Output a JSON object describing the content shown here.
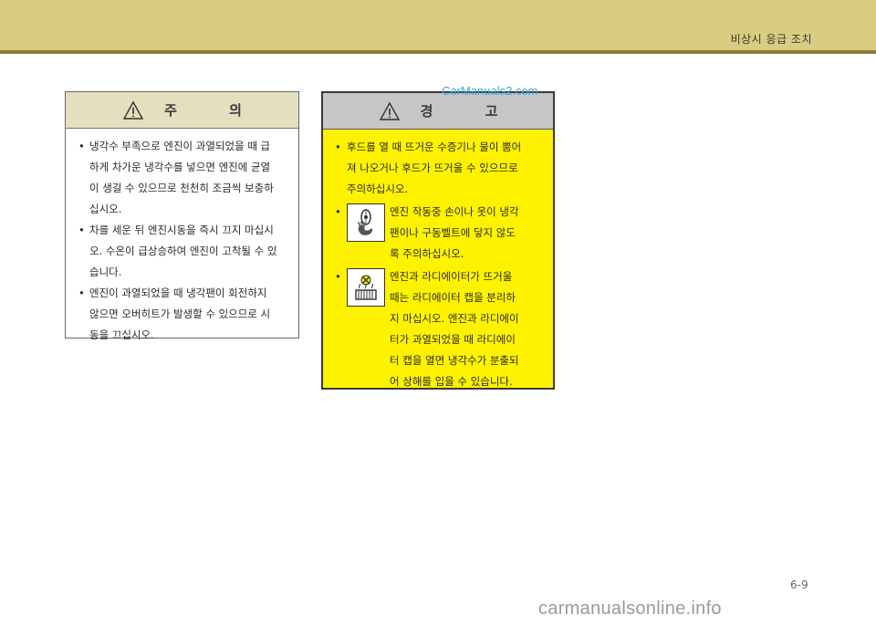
{
  "header": {
    "section_title": "비상시 응급 조치"
  },
  "caution": {
    "title": "주   의",
    "items": [
      {
        "lines": [
          "냉각수 부족으로 엔진이 과열되었을 때 급",
          "하게 차가운 냉각수를 넣으면 엔진에 균열",
          "이 생길 수 있으므로 천천히 조금씩 보충하",
          "십시오."
        ]
      },
      {
        "lines": [
          "차를 세운 뒤 엔진시동을 즉시 끄지 마십시",
          "오. 수온이 급상승하여 엔진이 고착될 수 있",
          "습니다."
        ]
      },
      {
        "lines": [
          "엔진이 과열되었을 때 냉각팬이 회전하지",
          "않으면 오버히트가 발생할 수 있으므로 시",
          "동을 끄십시오."
        ]
      }
    ]
  },
  "warning": {
    "title": "경   고",
    "item1": {
      "lines": [
        "후드를 열 때 뜨거운 수증기나 물이 뿜어",
        "져 나오거나 후드가 뜨거울 수 있으므로",
        "주의하십시오."
      ]
    },
    "item2": {
      "icon": "fan-hand-warning-icon",
      "lines": [
        "엔진 작동중 손이나 옷이 냉각",
        "팬이나 구동벨트에 닿지 않도",
        "록 주의하십시오."
      ]
    },
    "item3": {
      "icon": "radiator-cap-steam-icon",
      "lines": [
        "엔진과 라디에이터가 뜨거울",
        "때는 라디에이터 캡을 분리하",
        "지 마십시오. 엔진과 라디에이",
        "터가 과열되었을 때 라디에이",
        "터 캡을 열면 냉각수가 분출되",
        "어 상해를 입을 수 있습니다."
      ]
    }
  },
  "watermark": "CarManuals2.com",
  "page_number": "6-9",
  "footer_watermark": "carmanualsonline.info",
  "colors": {
    "band": "#d8cd83",
    "warning_bg": "#fff200",
    "caution_head": "#e3dfbf"
  }
}
